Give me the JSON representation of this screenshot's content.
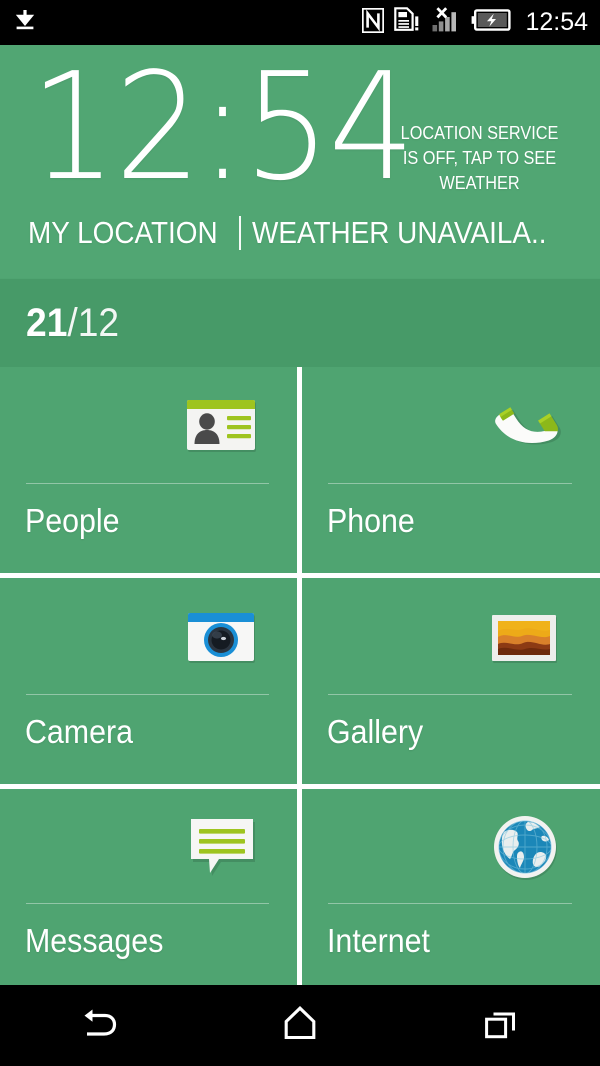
{
  "status_bar": {
    "clock": "12:54",
    "left_icons": [
      {
        "name": "download-icon",
        "label": "Download"
      }
    ],
    "right_icons": [
      {
        "name": "nfc-icon",
        "label": "NFC"
      },
      {
        "name": "sim-card-warning-icon",
        "label": "SIM card alert"
      },
      {
        "name": "signal-no-service-icon",
        "label": "No signal"
      },
      {
        "name": "battery-charging-icon",
        "label": "Battery charging"
      }
    ]
  },
  "clock_widget": {
    "time": "12:54",
    "weather_note": "LOCATION SERVICE IS OFF, TAP TO SEE WEATHER",
    "location_label": "MY LOCATION",
    "weather_status": "WEATHER UNAVAILA.."
  },
  "date_widget": {
    "day": "21",
    "rest": "/12",
    "full": "21/12"
  },
  "app_grid": {
    "tiles": [
      {
        "label": "People",
        "icon": "contact-card-icon"
      },
      {
        "label": "Phone",
        "icon": "phone-handset-icon"
      },
      {
        "label": "Camera",
        "icon": "camera-icon"
      },
      {
        "label": "Gallery",
        "icon": "gallery-photo-icon"
      },
      {
        "label": "Messages",
        "icon": "message-bubble-icon"
      },
      {
        "label": "Internet",
        "icon": "globe-icon"
      }
    ]
  },
  "nav_bar": {
    "buttons": [
      {
        "name": "back-button",
        "label": "Back"
      },
      {
        "name": "home-button",
        "label": "Home"
      },
      {
        "name": "recents-button",
        "label": "Recent apps"
      }
    ]
  },
  "colors": {
    "wallpaper_green": "#4fa471",
    "widget_green": "#51a673",
    "date_bar_green": "#479a68",
    "grid_divider": "#ffffff",
    "status_bar": "#000000",
    "accent_lime": "#9ec41f",
    "accent_blue": "#1a8fd6"
  }
}
